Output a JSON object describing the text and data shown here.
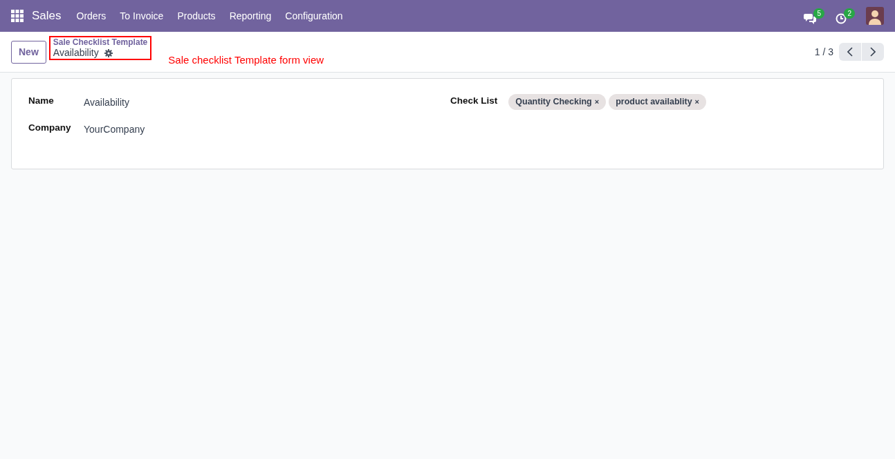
{
  "navbar": {
    "app": "Sales",
    "menu": [
      {
        "label": "Orders"
      },
      {
        "label": "To Invoice"
      },
      {
        "label": "Products"
      },
      {
        "label": "Reporting"
      },
      {
        "label": "Configuration"
      }
    ],
    "messages_count": "5",
    "activities_count": "2"
  },
  "control_panel": {
    "new_button": "New",
    "breadcrumb": "Sale Checklist Template",
    "record": "Availability",
    "pager": "1 / 3"
  },
  "annotation": {
    "text": "Sale checklist Template form view",
    "color": "#ff0000"
  },
  "form": {
    "fields": [
      {
        "label": "Name",
        "value": "Availability"
      },
      {
        "label": "Company",
        "value": "YourCompany"
      }
    ],
    "checklist": {
      "label": "Check List",
      "tags": [
        {
          "text": "Quantity Checking",
          "remove": "×"
        },
        {
          "text": "product availablity",
          "remove": "×"
        }
      ]
    }
  }
}
